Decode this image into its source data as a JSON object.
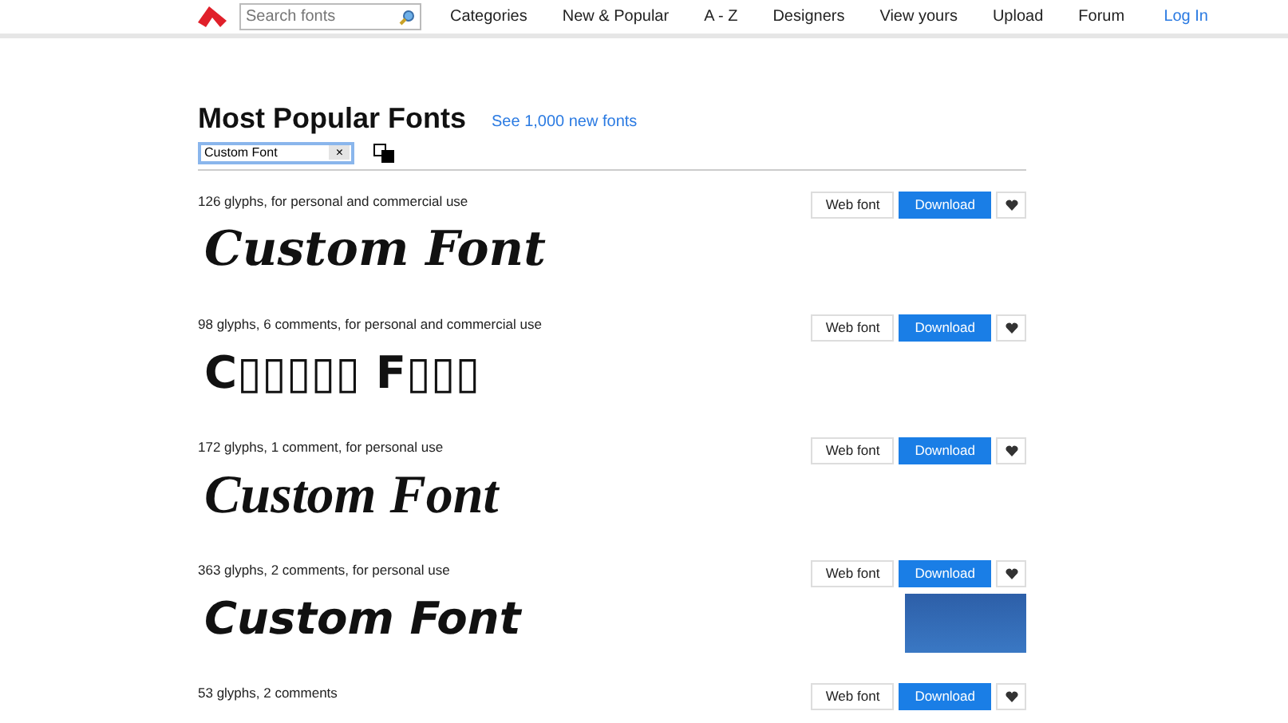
{
  "nav": {
    "search": {
      "placeholder": "Search fonts"
    },
    "links": [
      "Categories",
      "New & Popular",
      "A - Z",
      "Designers",
      "View yours",
      "Upload",
      "Forum"
    ],
    "login": "Log In"
  },
  "heading": {
    "title": "Most Popular Fonts",
    "link": "See 1,000 new fonts"
  },
  "filter": {
    "value": "Custom Font",
    "clear": "×"
  },
  "fonts": [
    {
      "info": "126 glyphs, for personal and commercial use",
      "preview": "Custom Font",
      "kind": "brush",
      "thumbnail": false,
      "webfont": "Web font",
      "download": "Download"
    },
    {
      "info": "98 glyphs, 6 comments, for personal and commercial use",
      "preview": "C▯▯▯▯▯ F▯▯▯",
      "kind": "condensed",
      "thumbnail": false,
      "webfont": "Web font",
      "download": "Download"
    },
    {
      "info": "172 glyphs, 1 comment, for personal use",
      "preview": "Custom Font",
      "kind": "script",
      "thumbnail": false,
      "webfont": "Web font",
      "download": "Download"
    },
    {
      "info": "363 glyphs, 2 comments, for personal use",
      "preview": "Custom Font",
      "kind": "casual",
      "thumbnail": true,
      "webfont": "Web font",
      "download": "Download"
    },
    {
      "info": "53 glyphs, 2 comments",
      "thumbnail": false,
      "webfont": "Web font",
      "download": "Download"
    }
  ]
}
